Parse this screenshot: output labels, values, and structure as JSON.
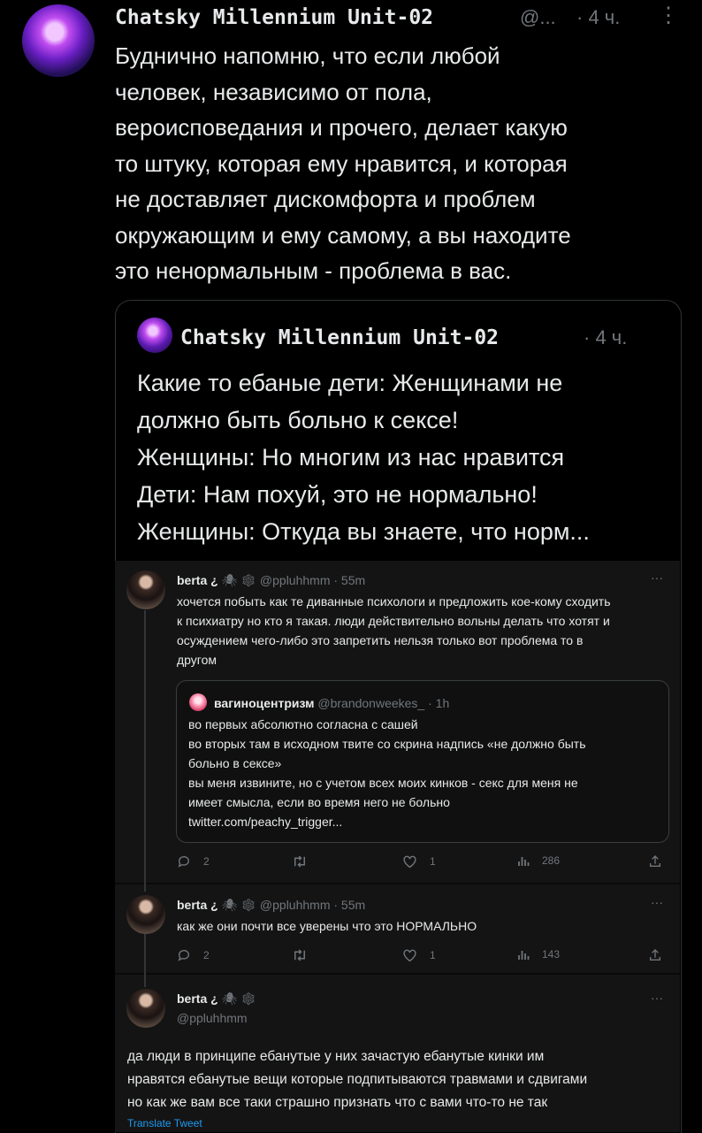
{
  "main_tweet": {
    "author": "Chatsky Millennium Unit-02",
    "handle": "@...",
    "time": "· 4 ч.",
    "more": "⋮",
    "lines": [
      "Буднично напомню, что если любой",
      "человек, независимо от пола,",
      "вероисповедания и прочего, делает какую",
      "то штуку, которая ему нравится, и которая",
      "не доставляет дискомфорта и проблем",
      "окружающим и ему самому, а вы находите",
      "это ненормальным - проблема в вас."
    ]
  },
  "quoted_tweet": {
    "author": "Chatsky Millennium Unit-02",
    "time": "· 4 ч.",
    "lines": [
      "Какие то ебаные дети: Женщинами не",
      "должно быть больно к сексе!",
      "Женщины: Но многим из нас нравится",
      "Дети: Нам похуй, это не нормально!",
      "Женщины: Откуда вы знаете, что норм..."
    ]
  },
  "replies": [
    {
      "name": "berta ¿",
      "emojis": "🕷 ❄",
      "handle": "@ppluhhmm",
      "time": "· 55m",
      "more": "···",
      "lines": [
        "хочется побыть как те диванные психологи и предложить кое-кому сходить",
        "к психиатру но кто я такая. люди действительно вольны делать что хотят и",
        "осуждением чего-либо это запретить нельзя только вот проблема то в",
        "другом"
      ],
      "quote": {
        "name": "вагиноцентризм",
        "handle": "@brandonweekes_",
        "time": "· 1h",
        "lines": [
          "во первых абсолютно согласна с сашей",
          "во вторых там в исходном твите со скрина надпись «не должно быть",
          "больно в сексе»",
          "вы меня извините, но с учетом всех моих кинков - секс для меня не",
          "имеет смысла, если во время него не больно",
          "twitter.com/peachy_trigger..."
        ]
      },
      "stats": {
        "replies": "2",
        "retweets": "",
        "likes": "1",
        "views": "286"
      }
    },
    {
      "name": "berta ¿",
      "emojis": "🕷 ❄",
      "handle": "@ppluhhmm",
      "time": "· 55m",
      "more": "···",
      "lines": [
        "как же они почти все уверены что это НОРМАЛЬНО"
      ],
      "stats": {
        "replies": "2",
        "retweets": "",
        "likes": "1",
        "views": "143"
      }
    },
    {
      "name": "berta ¿",
      "emojis": "🕷 ❄",
      "handle": "@ppluhhmm",
      "more": "···",
      "lines": [
        "да люди в принципе ебанутые у них зачастую ебанутые кинки им",
        "нравятся ебанутые вещи которые подпитываются травмами и сдвигами",
        "но как же вам все таки страшно признать что с вами что-то не так"
      ],
      "translate": "Translate Tweet"
    }
  ],
  "colors": {
    "background": "#000000",
    "text": "#e7e9ea",
    "muted": "#71767b",
    "link": "#1d9bf0",
    "border": "#2f3336"
  }
}
